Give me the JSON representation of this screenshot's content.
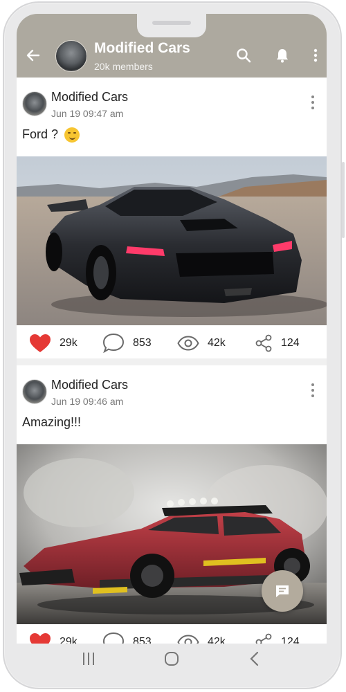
{
  "group": {
    "title": "Modified Cars",
    "members": "20k members"
  },
  "posts": [
    {
      "author": "Modified Cars",
      "date": "Jun 19 09:47 am",
      "text": "Ford ?",
      "emoji": "smirk-emoji",
      "stats": {
        "likes": "29k",
        "comments": "853",
        "views": "42k",
        "shares": "124"
      }
    },
    {
      "author": "Modified Cars",
      "date": "Jun 19 09:46 am",
      "text": "Amazing!!!",
      "stats": {
        "likes": "29k",
        "comments": "853",
        "views": "42k",
        "shares": "124"
      }
    }
  ],
  "icons": {
    "header": [
      "back-arrow-icon",
      "search-icon",
      "bell-icon",
      "more-vertical-icon"
    ],
    "post_actions": [
      "heart-icon",
      "comment-icon",
      "eye-icon",
      "share-icon"
    ],
    "nav": [
      "recent-apps-icon",
      "home-icon",
      "back-icon"
    ],
    "fab": "chat-icon"
  },
  "colors": {
    "header_bg": "#ada99f",
    "fab_bg": "#b3ab9d",
    "like_red": "#e53935"
  }
}
